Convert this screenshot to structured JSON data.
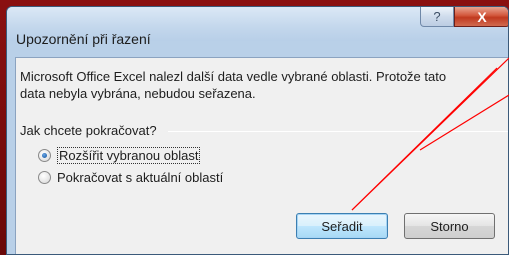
{
  "dialog": {
    "title": "Upozornění při řazení",
    "help_glyph": "?",
    "close_glyph": "X",
    "message_line1": "Microsoft Office Excel nalezl další data vedle vybrané oblasti. Protože tato",
    "message_line2": "data nebyla vybrána, nebudou seřazena.",
    "question": "Jak chcete pokračovat?",
    "options": [
      {
        "label": "Rozšířit vybranou oblast",
        "selected": true
      },
      {
        "label": "Pokračovat s aktuální oblastí",
        "selected": false
      }
    ],
    "sort_button": "Seřadit",
    "cancel_button": "Storno"
  },
  "annotation": {
    "color": "#ff0000"
  }
}
